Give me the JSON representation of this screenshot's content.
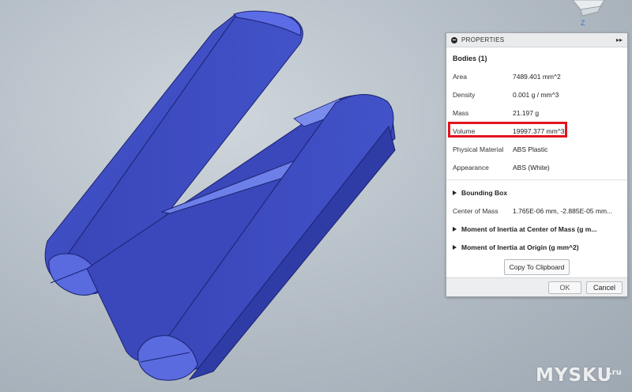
{
  "viewcube": {
    "axis_label": "Z"
  },
  "panel": {
    "title": "PROPERTIES",
    "section": "Bodies (1)",
    "properties": [
      {
        "key": "Area",
        "value": "7489.401 mm^2"
      },
      {
        "key": "Density",
        "value": "0.001 g / mm^3"
      },
      {
        "key": "Mass",
        "value": "21.197 g"
      },
      {
        "key": "Volume",
        "value": "19997.377 mm^3"
      },
      {
        "key": "Physical Material",
        "value": "ABS Plastic"
      },
      {
        "key": "Appearance",
        "value": "ABS (White)"
      }
    ],
    "bounding_box": "Bounding Box",
    "center_of_mass": {
      "key": "Center of Mass",
      "value": "1.765E-06 mm, -2.885E-05 mm..."
    },
    "moment_center": "Moment of Inertia at Center of Mass   (g m...",
    "moment_origin": "Moment of Inertia at Origin   (g mm^2)",
    "copy_label": "Copy To Clipboard",
    "ok_label": "OK",
    "cancel_label": "Cancel"
  },
  "watermark": {
    "main": "MYSKU",
    "suffix": ".ru"
  },
  "colors": {
    "model_face": "#3f4fc4",
    "model_side": "#2e3aa0",
    "highlight": "#e3141c"
  }
}
